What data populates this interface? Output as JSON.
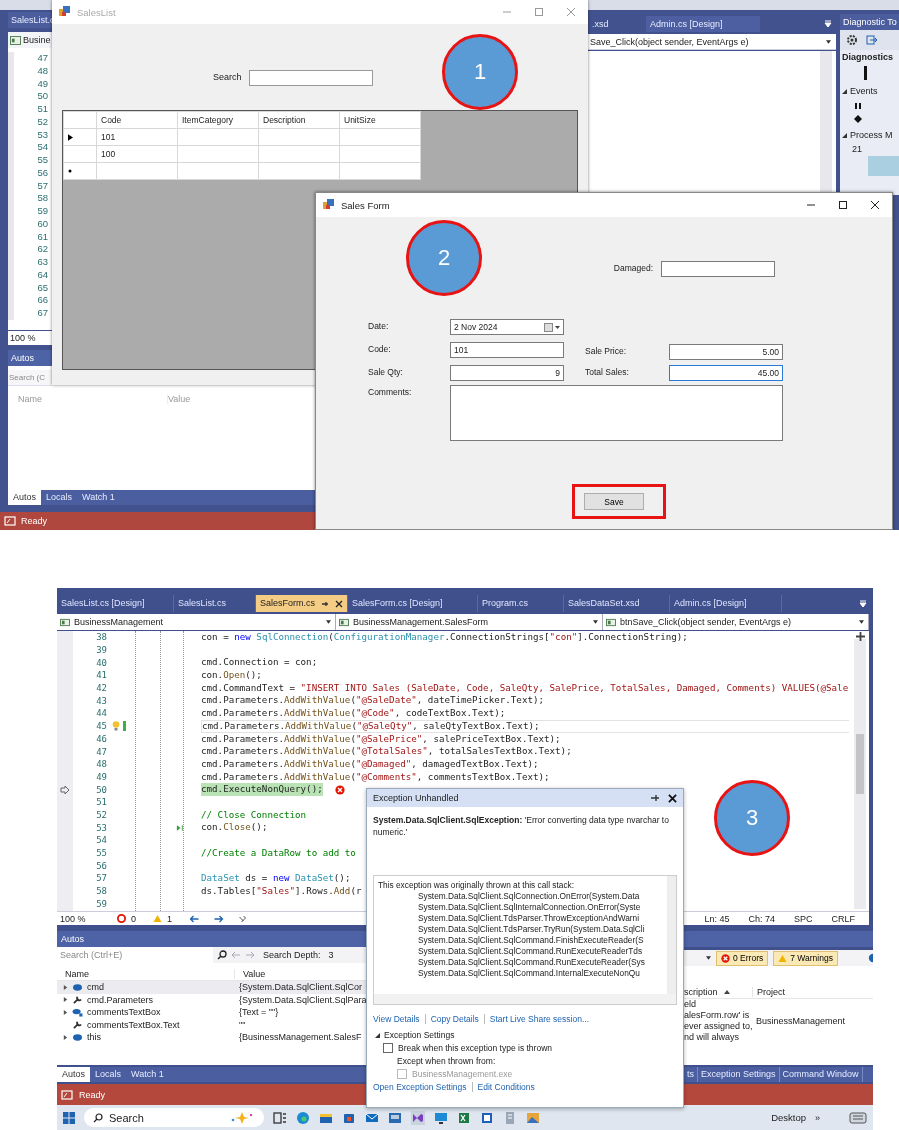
{
  "top_shot": {
    "ide": {
      "left_tab": "SalesList.c",
      "left_nav": "Busine",
      "line_numbers": [
        "47",
        "48",
        "49",
        "50",
        "51",
        "52",
        "53",
        "54",
        "55",
        "56",
        "57",
        "58",
        "59",
        "60",
        "61",
        "62",
        "63",
        "64",
        "65",
        "66",
        "67"
      ],
      "zoom": "100 %",
      "autos": {
        "title": "Autos",
        "placeholder": "Search (C",
        "columns": [
          "Name",
          "Value"
        ],
        "tabs": [
          {
            "label": "Autos",
            "selected": true
          },
          {
            "label": "Locals",
            "selected": false
          },
          {
            "label": "Watch 1",
            "selected": false
          }
        ]
      },
      "status": "Ready",
      "right_tabs": [
        ".xsd",
        "Admin.cs [Design]"
      ],
      "method_dropdown": "Save_Click(object sender, EventArgs e)",
      "diagnostics": {
        "title": "Diagnostic To",
        "section": "Diagnostics",
        "events": "Events",
        "process": "Process M",
        "value": "21"
      }
    },
    "sales_list": {
      "title": "SalesList",
      "search_label": "Search",
      "columns": [
        "Code",
        "ItemCategory",
        "Description",
        "UnitSize"
      ],
      "rows": [
        {
          "cells": [
            "101"
          ],
          "current": true
        },
        {
          "cells": [
            "100"
          ],
          "current": false
        }
      ],
      "callout": "1"
    },
    "sales_form": {
      "title": "Sales Form",
      "callout": "2",
      "fields": [
        {
          "kind": "text",
          "label": "Damaged:",
          "focused": false
        },
        {
          "kind": "date",
          "label": "Date:",
          "value": "2 Nov 2024",
          "focused": false
        },
        {
          "kind": "text",
          "label": "Code:",
          "value": "101",
          "focused": false
        },
        {
          "kind": "text",
          "label": "Sale Price:",
          "value": "5.00",
          "focused": false
        },
        {
          "kind": "text",
          "label": "Sale Qty:",
          "value": "9",
          "focused": false
        },
        {
          "kind": "text",
          "label": "Total Sales:",
          "value": "45.00",
          "focused": true
        },
        {
          "kind": "textarea",
          "label": "Comments:",
          "focused": false
        }
      ],
      "save_button": {
        "label": "Save",
        "highlighted": true
      }
    }
  },
  "bottom_shot": {
    "doc_tabs": [
      {
        "label": "SalesList.cs [Design]",
        "selected": false
      },
      {
        "label": "SalesList.cs",
        "selected": false
      },
      {
        "label": "SalesForm.cs",
        "selected": true
      },
      {
        "label": "SalesForm.cs [Design]",
        "selected": false
      },
      {
        "label": "Program.cs",
        "selected": false
      },
      {
        "label": "SalesDataSet.xsd",
        "selected": false
      },
      {
        "label": "Admin.cs [Design]",
        "selected": false
      }
    ],
    "nav": [
      "BusinessManagement",
      "BusinessManagement.SalesForm",
      "btnSave_Click(object sender, EventArgs e)"
    ],
    "code_lines": [
      {
        "number": "38",
        "segments": [
          {
            "kind": "plain",
            "text": "con = "
          },
          {
            "kind": "keyword",
            "text": "new"
          },
          {
            "kind": "type",
            "text": " SqlConnection"
          },
          {
            "kind": "plain",
            "text": "("
          },
          {
            "kind": "type",
            "text": "ConfigurationManager"
          },
          {
            "kind": "plain",
            "text": ".ConnectionStrings["
          },
          {
            "kind": "string",
            "text": "\"con\""
          },
          {
            "kind": "plain",
            "text": "].ConnectionString);"
          }
        ]
      },
      {
        "number": "39"
      },
      {
        "number": "40",
        "segments": [
          {
            "kind": "plain",
            "text": "cmd.Connection = con;"
          }
        ]
      },
      {
        "number": "41",
        "segments": [
          {
            "kind": "plain",
            "text": "con."
          },
          {
            "kind": "method",
            "text": "Open"
          },
          {
            "kind": "plain",
            "text": "();"
          }
        ]
      },
      {
        "number": "42",
        "segments": [
          {
            "kind": "plain",
            "text": "cmd.CommandText = "
          },
          {
            "kind": "string",
            "text": "\"INSERT INTO Sales (SaleDate, Code, SaleQty, SalePrice, TotalSales, Damaged, Comments) VALUES(@Sale"
          }
        ]
      },
      {
        "number": "43",
        "segments": [
          {
            "kind": "plain",
            "text": "cmd.Parameters."
          },
          {
            "kind": "method",
            "text": "AddWithValue"
          },
          {
            "kind": "plain",
            "text": "("
          },
          {
            "kind": "string",
            "text": "\"@SaleDate\""
          },
          {
            "kind": "plain",
            "text": ", dateTimePicker.Text);"
          }
        ]
      },
      {
        "number": "44",
        "segments": [
          {
            "kind": "plain",
            "text": "cmd.Parameters."
          },
          {
            "kind": "method",
            "text": "AddWithValue"
          },
          {
            "kind": "plain",
            "text": "("
          },
          {
            "kind": "string",
            "text": "\"@Code\""
          },
          {
            "kind": "plain",
            "text": ", codeTextBox.Text);"
          }
        ]
      },
      {
        "number": "45",
        "lightbulb": true,
        "changed": true,
        "active": true,
        "segments": [
          {
            "kind": "plain",
            "text": "cmd.Parameters."
          },
          {
            "kind": "method",
            "text": "AddWithValue"
          },
          {
            "kind": "plain",
            "text": "("
          },
          {
            "kind": "string",
            "text": "\"@SaleQty\""
          },
          {
            "kind": "plain",
            "text": ", saleQtyTextBox.Text);"
          }
        ]
      },
      {
        "number": "46",
        "segments": [
          {
            "kind": "plain",
            "text": "cmd.Parameters."
          },
          {
            "kind": "method",
            "text": "AddWithValue"
          },
          {
            "kind": "plain",
            "text": "("
          },
          {
            "kind": "string",
            "text": "\"@SalePrice\""
          },
          {
            "kind": "plain",
            "text": ", salePriceTextBox.Text);"
          }
        ]
      },
      {
        "number": "47",
        "segments": [
          {
            "kind": "plain",
            "text": "cmd.Parameters."
          },
          {
            "kind": "method",
            "text": "AddWithValue"
          },
          {
            "kind": "plain",
            "text": "("
          },
          {
            "kind": "string",
            "text": "\"@TotalSales\""
          },
          {
            "kind": "plain",
            "text": ", totalSalesTextBox.Text);"
          }
        ]
      },
      {
        "number": "48",
        "segments": [
          {
            "kind": "plain",
            "text": "cmd.Parameters."
          },
          {
            "kind": "method",
            "text": "AddWithValue"
          },
          {
            "kind": "plain",
            "text": "("
          },
          {
            "kind": "string",
            "text": "\"@Damaged\""
          },
          {
            "kind": "plain",
            "text": ", damagedTextBox.Text);"
          }
        ]
      },
      {
        "number": "49",
        "segments": [
          {
            "kind": "plain",
            "text": "cmd.Parameters."
          },
          {
            "kind": "method",
            "text": "AddWithValue"
          },
          {
            "kind": "plain",
            "text": "("
          },
          {
            "kind": "string",
            "text": "\"@Comments\""
          },
          {
            "kind": "plain",
            "text": ", commentsTextBox.Text);"
          }
        ]
      },
      {
        "number": "50",
        "exception_pointer": true,
        "current": true,
        "error": true,
        "segments": [
          {
            "kind": "plain",
            "text": "cmd.ExecuteNonQuery();"
          }
        ]
      },
      {
        "number": "51"
      },
      {
        "number": "52",
        "segments": [
          {
            "kind": "comment",
            "text": "// Close Connection"
          }
        ]
      },
      {
        "number": "53",
        "run_to_click": true,
        "segments": [
          {
            "kind": "plain",
            "text": "con."
          },
          {
            "kind": "method",
            "text": "Close"
          },
          {
            "kind": "plain",
            "text": "();"
          }
        ]
      },
      {
        "number": "54"
      },
      {
        "number": "55",
        "segments": [
          {
            "kind": "comment",
            "text": "//Create a DataRow to add to"
          }
        ]
      },
      {
        "number": "56"
      },
      {
        "number": "57",
        "segments": [
          {
            "kind": "type",
            "text": "DataSet"
          },
          {
            "kind": "plain",
            "text": " ds = "
          },
          {
            "kind": "keyword",
            "text": "new"
          },
          {
            "kind": "type",
            "text": " DataSet"
          },
          {
            "kind": "plain",
            "text": "();"
          }
        ]
      },
      {
        "number": "58",
        "segments": [
          {
            "kind": "plain",
            "text": "ds.Tables["
          },
          {
            "kind": "string",
            "text": "\"Sales\""
          },
          {
            "kind": "plain",
            "text": "].Rows."
          },
          {
            "kind": "method",
            "text": "Add"
          },
          {
            "kind": "plain",
            "text": "(r"
          }
        ]
      },
      {
        "number": "59"
      }
    ],
    "editor_status": {
      "zoom": "100 %",
      "errors": "0",
      "warnings": "1",
      "position": [
        "Ln: 45",
        "Ch: 74",
        "SPC",
        "CRLF"
      ]
    },
    "exception": {
      "title": "Exception Unhandled",
      "message": "**System.Data.SqlClient.SqlException:** 'Error converting data type nvarchar to numeric.'",
      "stack_intro": "This exception was originally thrown at this call stack:",
      "stack": [
        "System.Data.SqlClient.SqlConnection.OnError(System.Data",
        "System.Data.SqlClient.SqlInternalConnection.OnError(Syste",
        "System.Data.SqlClient.TdsParser.ThrowExceptionAndWarni",
        "System.Data.SqlClient.TdsParser.TryRun(System.Data.SqlCli",
        "System.Data.SqlClient.SqlCommand.FinishExecuteReader(S",
        "System.Data.SqlClient.SqlCommand.RunExecuteReaderTds",
        "System.Data.SqlClient.SqlCommand.RunExecuteReader(Sys",
        "System.Data.SqlClient.SqlCommand.InternalExecuteNonQu"
      ],
      "links": [
        "View Details",
        "Copy Details",
        "Start Live Share session..."
      ],
      "settings_title": "Exception Settings",
      "settings_expanded": true,
      "options": [
        {
          "label": "Break when this exception type is thrown",
          "checked": false,
          "disabled": false
        }
      ],
      "except_label": "Except when thrown from:",
      "modules": [
        {
          "label": "BusinessManagement.exe",
          "checked": false,
          "disabled": true
        }
      ],
      "footer_links": [
        "Open Exception Settings",
        "Edit Conditions"
      ]
    },
    "callout": "3",
    "autos": {
      "title": "Autos",
      "placeholder": "Search (Ctrl+E)",
      "depth_label": "Search Depth:",
      "depth": "3",
      "columns": [
        "Name",
        "Value"
      ],
      "rows": [
        {
          "name": "cmd",
          "value": "{System.Data.SqlClient.SqlCor",
          "kind": "object",
          "expandable": true
        },
        {
          "name": "cmd.Parameters",
          "value": "{System.Data.SqlClient.SqlPara",
          "kind": "property",
          "expandable": true
        },
        {
          "name": "commentsTextBox",
          "value": "{Text = \"\"}",
          "kind": "field",
          "expandable": true
        },
        {
          "name": "commentsTextBox.Text",
          "value": "\"\"",
          "kind": "property",
          "expandable": false
        },
        {
          "name": "this",
          "value": "{BusinessManagement.SalesF",
          "kind": "object",
          "expandable": true
        }
      ],
      "tabs": [
        {
          "label": "Autos",
          "selected": true
        },
        {
          "label": "Locals",
          "selected": false
        },
        {
          "label": "Watch 1",
          "selected": false
        }
      ]
    },
    "error_list": {
      "errors": "0 Errors",
      "warnings": "7 Warnings",
      "columns": [
        "scription",
        "Project"
      ],
      "description": [
        "eld",
        "alesForm.row' is",
        "ever assigned to,",
        "nd will always"
      ],
      "project": "BusinessManagement"
    },
    "tool_tabs": [
      "ts",
      "Exception Settings",
      "Command Window"
    ],
    "status": "Ready",
    "taskbar": {
      "search": "Search",
      "desktop": "Desktop",
      "more": "»"
    }
  }
}
